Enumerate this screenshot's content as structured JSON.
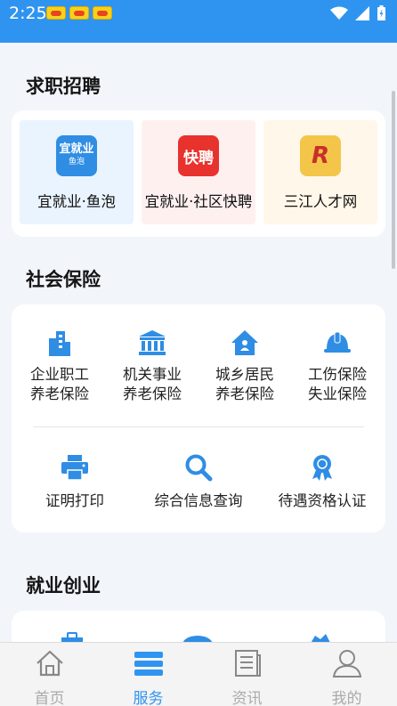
{
  "status": {
    "time": "2:25"
  },
  "sections": {
    "jobs": {
      "title": "求职招聘"
    },
    "insurance": {
      "title": "社会保险"
    },
    "employment": {
      "title": "就业创业"
    }
  },
  "jobs": [
    {
      "label": "宜就业·鱼泡",
      "logo_text": "宜就业",
      "logo_sub": "鱼泡",
      "bg": "#eaf4ff",
      "logo_color": "#2f8de4"
    },
    {
      "label": "宜就业·社区快聘",
      "logo_text": "快聘",
      "bg": "#fff0f0",
      "logo_color": "#e8322e"
    },
    {
      "label": "三江人才网",
      "logo_text": "R",
      "bg": "#fff7ea",
      "logo_color": "#f3c64a"
    }
  ],
  "insurance_row1": [
    {
      "line1": "企业职工",
      "line2": "养老保险",
      "icon": "building-icon"
    },
    {
      "line1": "机关事业",
      "line2": "养老保险",
      "icon": "bank-icon"
    },
    {
      "line1": "城乡居民",
      "line2": "养老保险",
      "icon": "home-icon"
    },
    {
      "line1": "工伤保险",
      "line2": "失业保险",
      "icon": "helmet-icon"
    }
  ],
  "insurance_row2": [
    {
      "label": "证明打印",
      "icon": "printer-icon"
    },
    {
      "label": "综合信息查询",
      "icon": "search-icon"
    },
    {
      "label": "待遇资格认证",
      "icon": "award-icon"
    }
  ],
  "tabs": [
    {
      "label": "首页",
      "icon": "home-icon",
      "active": false
    },
    {
      "label": "服务",
      "icon": "list-icon",
      "active": true
    },
    {
      "label": "资讯",
      "icon": "news-icon",
      "active": false
    },
    {
      "label": "我的",
      "icon": "user-icon",
      "active": false
    }
  ],
  "colors": {
    "primary": "#2f94f0",
    "icon_blue": "#2f8de4"
  }
}
